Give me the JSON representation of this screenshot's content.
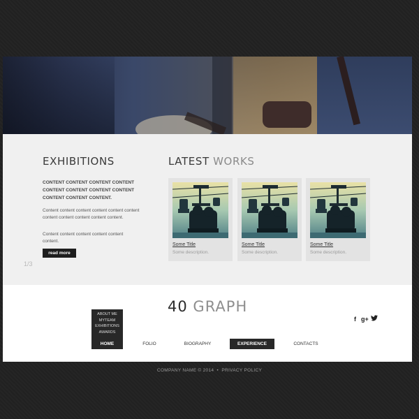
{
  "exhibitions": {
    "title": "EXHIBITIONS",
    "bold_text": "CONTENT CONTENT CONTENT CONTENT CONTENT CONTENT CONTENT CONTENT CONTENT CONTENT CONTENT.",
    "paragraph1": "Content content content content content content content content content content content.",
    "paragraph2": "Content content content content content content.",
    "read_more": "read more"
  },
  "slider": {
    "counter": "1/3"
  },
  "latest_works": {
    "title_strong": "LATEST",
    "title_light": "WORKS",
    "items": [
      {
        "title": "Some Title",
        "description": "Some description."
      },
      {
        "title": "Some Title",
        "description": "Some description."
      },
      {
        "title": "Some Title",
        "description": "Some description."
      }
    ]
  },
  "logo": {
    "number": "40",
    "word": "GRAPH"
  },
  "submenu": {
    "items": [
      "ABOUT ME",
      "MYTEAM",
      "EXHIBITIONS",
      "AWARDS"
    ]
  },
  "nav": {
    "items": [
      "HOME",
      "FOLIO",
      "BIOGRAPHY",
      "EXPERIENCE",
      "CONTACTS"
    ]
  },
  "social": {
    "facebook": "f",
    "googleplus": "g+"
  },
  "footer": {
    "copyright": "COMPANY NAME © 2014",
    "separator": "•",
    "privacy": "PRIVACY POLICY"
  },
  "icons": {
    "twitter": "twitter-icon",
    "facebook": "facebook-icon",
    "googleplus": "google-plus-icon"
  }
}
